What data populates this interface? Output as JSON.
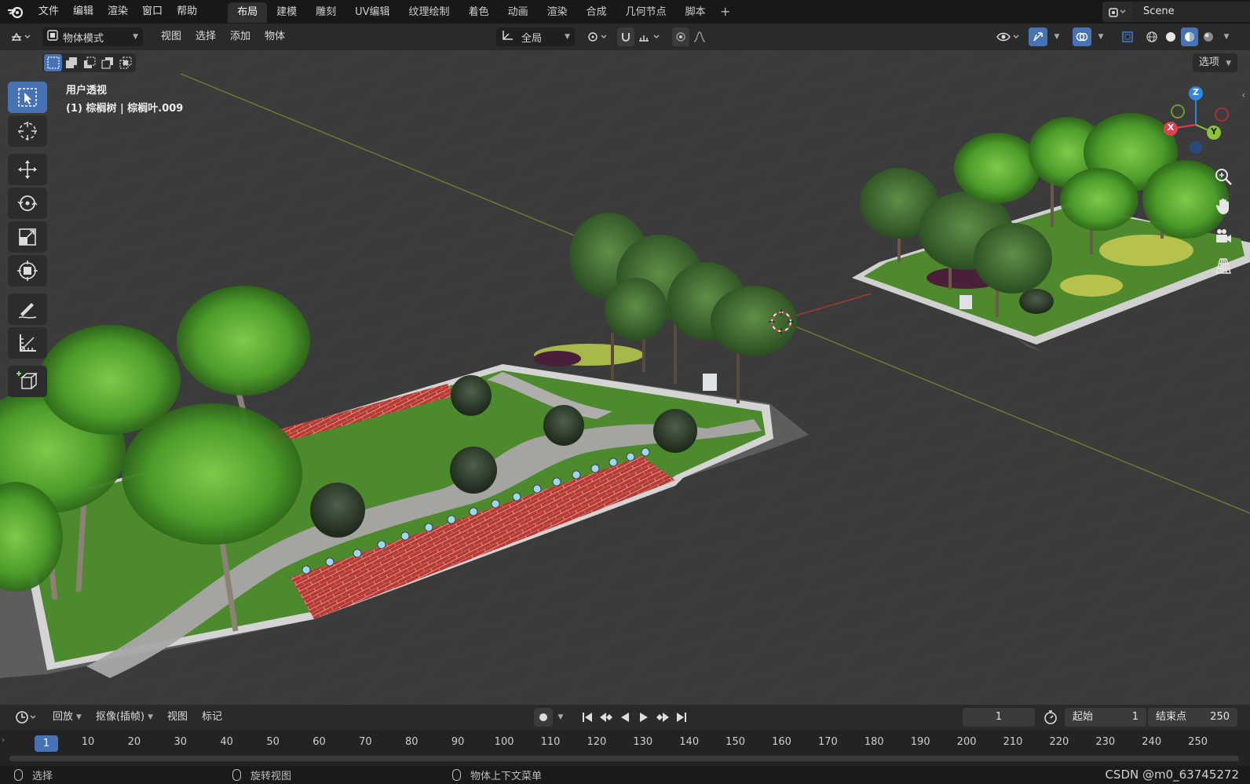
{
  "menu": {
    "items": [
      "文件",
      "编辑",
      "渲染",
      "窗口",
      "帮助"
    ]
  },
  "workspaces": {
    "tabs": [
      "布局",
      "建模",
      "雕刻",
      "UV编辑",
      "纹理绘制",
      "着色",
      "动画",
      "渲染",
      "合成",
      "几何节点",
      "脚本"
    ],
    "active": "布局",
    "add_label": "+"
  },
  "scene": {
    "name": "Scene"
  },
  "viewport_header": {
    "mode": "物体模式",
    "menus": [
      "视图",
      "选择",
      "添加",
      "物体"
    ],
    "transform_orientation": "全局",
    "options_label": "选项"
  },
  "viewport": {
    "view_name": "用户透视",
    "object_info": "(1) 棕榈树 | 棕榈叶.009",
    "gizmo_axes": {
      "x": "X",
      "y": "Y",
      "z": "Z"
    }
  },
  "timeline": {
    "menus": [
      "回放",
      "抠像(插帧)",
      "视图",
      "标记"
    ],
    "current_frame": "1",
    "start_label": "起始",
    "start_value": "1",
    "end_label": "结束点",
    "end_value": "250",
    "ruler_current": "1",
    "ruler_ticks": [
      "10",
      "20",
      "30",
      "40",
      "50",
      "60",
      "70",
      "80",
      "90",
      "100",
      "110",
      "120",
      "130",
      "140",
      "150",
      "160",
      "170",
      "180",
      "190",
      "200",
      "210",
      "220",
      "230",
      "240",
      "250"
    ]
  },
  "statusbar": {
    "select": "选择",
    "rotate_view": "旋转视图",
    "context_menu": "物体上下文菜单",
    "watermark": "CSDN @m0_63745272"
  },
  "colors": {
    "accent": "#4772b3",
    "axis_x": "#e04050",
    "axis_y": "#8ac33a",
    "axis_z": "#2f87e0",
    "grass": "#4e8a2e",
    "brick": "#b83a34"
  }
}
